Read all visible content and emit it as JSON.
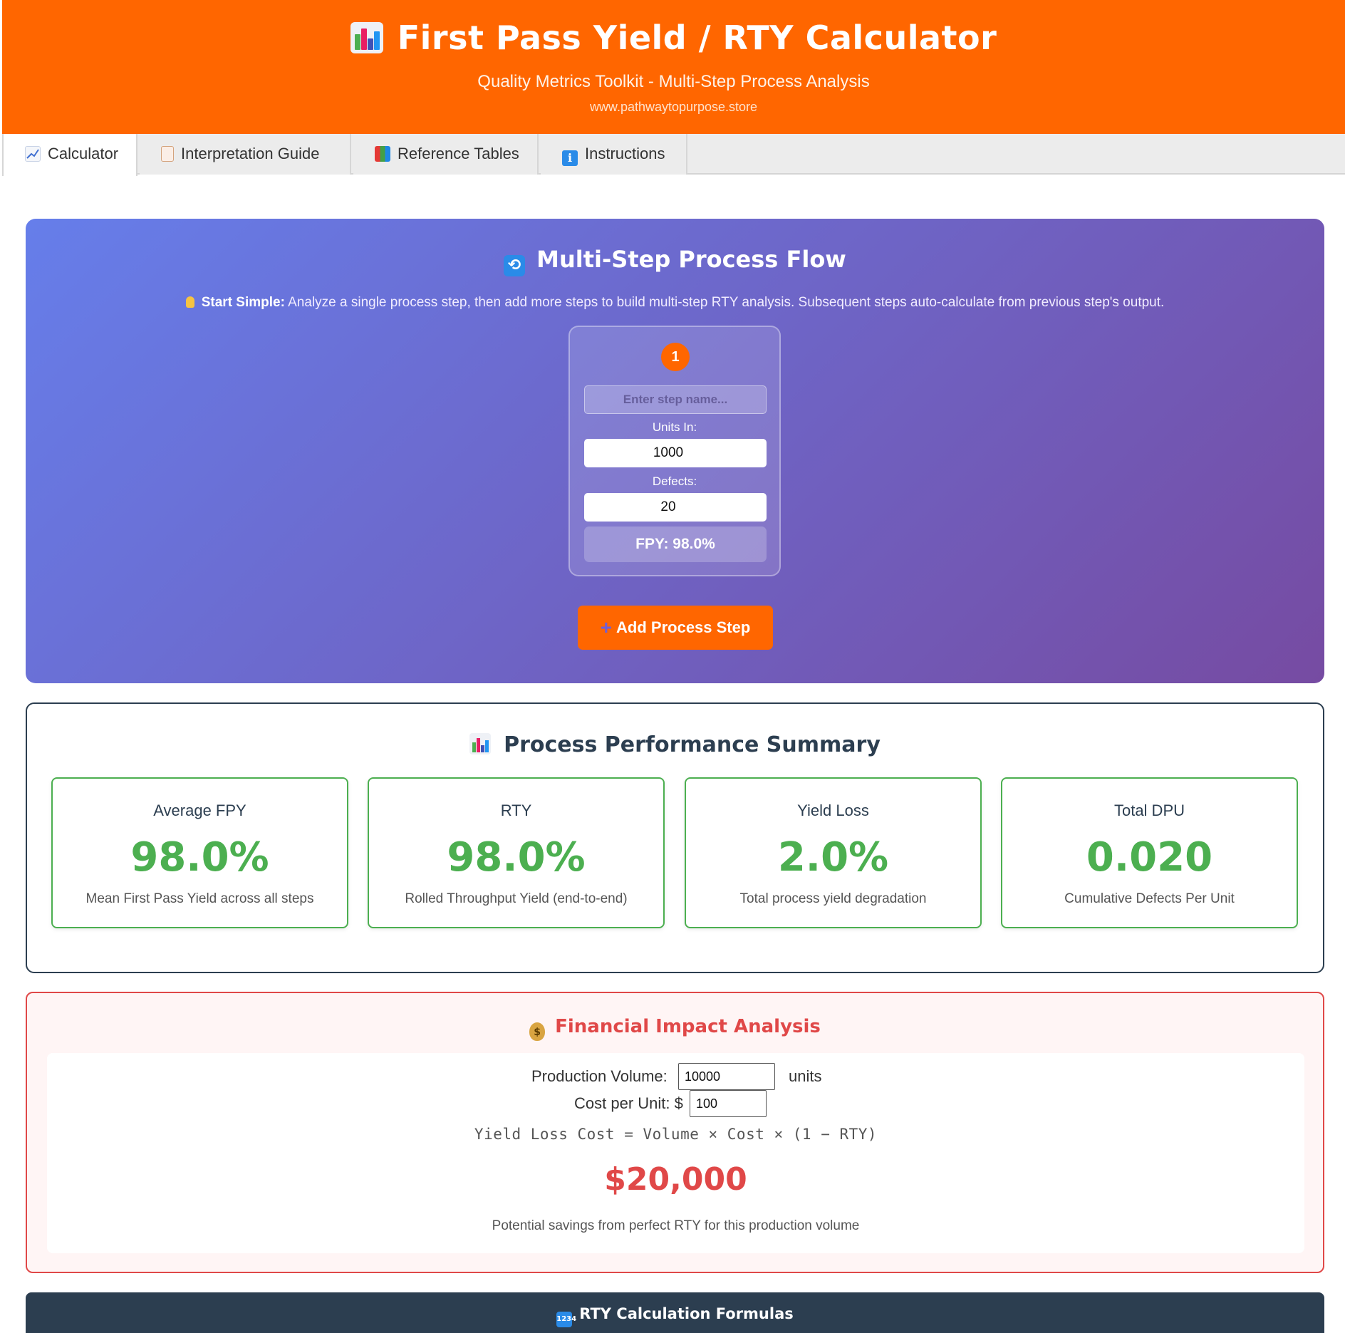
{
  "app": {
    "title": "First Pass Yield / RTY Calculator",
    "subtitle": "Quality Metrics Toolkit - Multi-Step Process Analysis",
    "website": "www.pathwaytopurpose.store"
  },
  "tabs": [
    {
      "label": "Calculator",
      "icon": "chart-increasing-icon",
      "active": true
    },
    {
      "label": "Interpretation Guide",
      "icon": "clipboard-icon",
      "active": false
    },
    {
      "label": "Reference Tables",
      "icon": "books-icon",
      "active": false
    },
    {
      "label": "Instructions",
      "icon": "info-icon",
      "active": false
    }
  ],
  "process_flow": {
    "title": "Multi-Step Process Flow",
    "tip_bold": "Start Simple:",
    "tip_text": " Analyze a single process step, then add more steps to build multi-step RTY analysis. Subsequent steps auto-calculate from previous step's output.",
    "steps": [
      {
        "number": "1",
        "name_placeholder": "Enter step name...",
        "units_in_label": "Units In:",
        "units_in": "1000",
        "defects_label": "Defects:",
        "defects": "20",
        "fpy": "FPY: 98.0%"
      }
    ],
    "add_step_label": "Add Process Step"
  },
  "summary": {
    "title": "Process Performance Summary",
    "metrics": [
      {
        "label": "Average FPY",
        "value": "98.0%",
        "description": "Mean First Pass Yield across all steps"
      },
      {
        "label": "RTY",
        "value": "98.0%",
        "description": "Rolled Throughput Yield (end-to-end)"
      },
      {
        "label": "Yield Loss",
        "value": "2.0%",
        "description": "Total process yield degradation"
      },
      {
        "label": "Total DPU",
        "value": "0.020",
        "description": "Cumulative Defects Per Unit"
      }
    ]
  },
  "financial": {
    "title": "Financial Impact Analysis",
    "volume_label": "Production Volume:",
    "volume_value": "10000",
    "volume_unit": "units",
    "cost_label": "Cost per Unit: $",
    "cost_value": "100",
    "formula": "Yield Loss Cost = Volume × Cost × (1 − RTY)",
    "result": "$20,000",
    "note": "Potential savings from perfect RTY for this production volume"
  },
  "formulas_section": {
    "title": "RTY Calculation Formulas"
  },
  "colors": {
    "brand_orange": "#ff6600",
    "success_green": "#4caf50",
    "danger_red": "#e04848",
    "dark_navy": "#2c3e50",
    "gradient_start": "#667eea",
    "gradient_end": "#764ba2"
  }
}
